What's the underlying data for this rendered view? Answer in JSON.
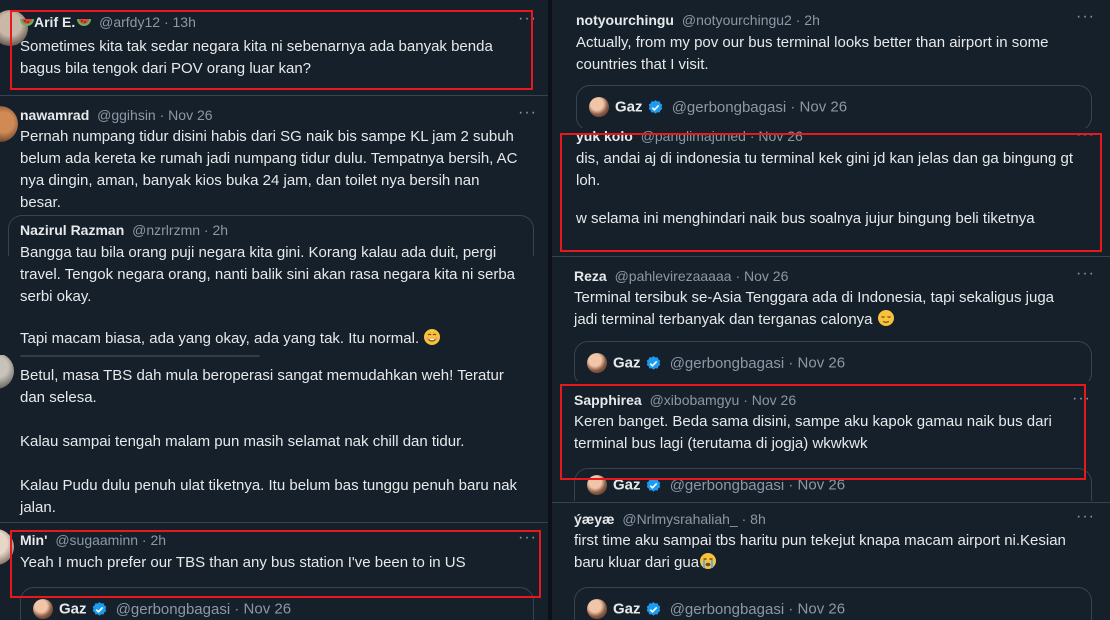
{
  "left": {
    "t1": {
      "name": "Arif E.",
      "handle": "@arfdy12",
      "time": "13h",
      "more": "···",
      "lines": [
        "Sometimes kita tak sedar negara kita ni sebenarnya ada banyak benda",
        "bagus bila tengok dari POV orang luar kan?"
      ]
    },
    "t2": {
      "name": "nawamrad",
      "handle": "@ggihsin",
      "time": "Nov 26",
      "more": "···",
      "lines": [
        "Pernah numpang tidur disini habis dari SG naik bis sampe KL jam 2 subuh",
        "belum ada kereta ke rumah jadi numpang tidur dulu. Tempatnya bersih, AC",
        "nya dingin, aman, banyak kios buka 24 jam, dan toilet nya bersih nan",
        "besar."
      ]
    },
    "t3": {
      "name": "Nazirul Razman",
      "handle": "@nzrlrzmn",
      "time": "2h",
      "lines": [
        "Bangga tau bila orang puji negara kita gini. Korang kalau ada duit, pergi",
        "travel. Tengok negara orang, nanti balik sini akan rasa negara kita ni serba",
        "serbi okay."
      ],
      "line2": "Tapi macam biasa, ada yang okay, ada yang tak. Itu normal."
    },
    "t4": {
      "paragraphs": [
        "Betul, masa TBS dah mula beroperasi sangat memudahkan weh! Teratur",
        "dan selesa.",
        "Kalau sampai tengah malam pun masih selamat nak chill dan tidur.",
        "Kalau Pudu dulu penuh ulat tiketnya. Itu belum bas tunggu penuh baru nak",
        "jalan."
      ]
    },
    "t5": {
      "name": "Min'",
      "handle": "@sugaaminn",
      "time": "2h",
      "more": "···",
      "text": "Yeah I much prefer our TBS than any bus station I've been to in US"
    },
    "quote": {
      "name": "Gaz",
      "handle": "@gerbongbagasi",
      "time": "Nov 26"
    }
  },
  "right": {
    "t1": {
      "name": "notyourchingu",
      "handle": "@notyourchingu2",
      "time": "2h",
      "more": "···",
      "lines": [
        "Actually, from my pov our bus terminal looks better than airport in some",
        "countries that I visit."
      ]
    },
    "t2": {
      "name": "yuk kolo",
      "handle": "@panglimajuned",
      "time": "Nov 26",
      "more": "···",
      "lines": [
        "dis, andai aj di indonesia tu terminal kek gini jd kan jelas dan ga bingung gt",
        "loh."
      ],
      "line2": "w selama ini menghindari naik bus soalnya jujur bingung beli tiketnya"
    },
    "t3": {
      "name": "Reza",
      "handle": "@pahlevirezaaaaa",
      "time": "Nov 26",
      "more": "···",
      "lines": [
        "Terminal tersibuk se-Asia Tenggara ada di Indonesia, tapi sekaligus juga",
        "jadi terminal terbanyak dan terganas calonya"
      ]
    },
    "t4": {
      "name": "Sapphirea",
      "handle": "@xibobamgyu",
      "time": "Nov 26",
      "more": "···",
      "lines": [
        "Keren banget. Beda sama disini, sampe aku kapok gamau naik bus dari",
        "terminal bus lagi (terutama di jogja) wkwkwk"
      ]
    },
    "t5": {
      "name": "ýæyæ",
      "handle": "@Nrlmysrahaliah_",
      "time": "8h",
      "more": "···",
      "lines": [
        "first time aku sampai tbs haritu pun tekejut knapa macam airport ni.Kesian",
        "baru kluar dari gua"
      ]
    },
    "quote": {
      "name": "Gaz",
      "handle": "@gerbongbagasi",
      "time": "Nov 26"
    }
  },
  "colors": {
    "background": "#15202b",
    "text": "#e7e9ea",
    "muted": "#8b98a5",
    "border": "#38444d",
    "highlight": "#e8191c",
    "verified": "#1d9bf0"
  },
  "icons": [
    "more-dots-icon",
    "verified-badge-icon",
    "watermelon-emoji-icon",
    "smiling-face-emoji-icon",
    "relieved-face-emoji-icon",
    "crying-face-emoji-icon"
  ]
}
